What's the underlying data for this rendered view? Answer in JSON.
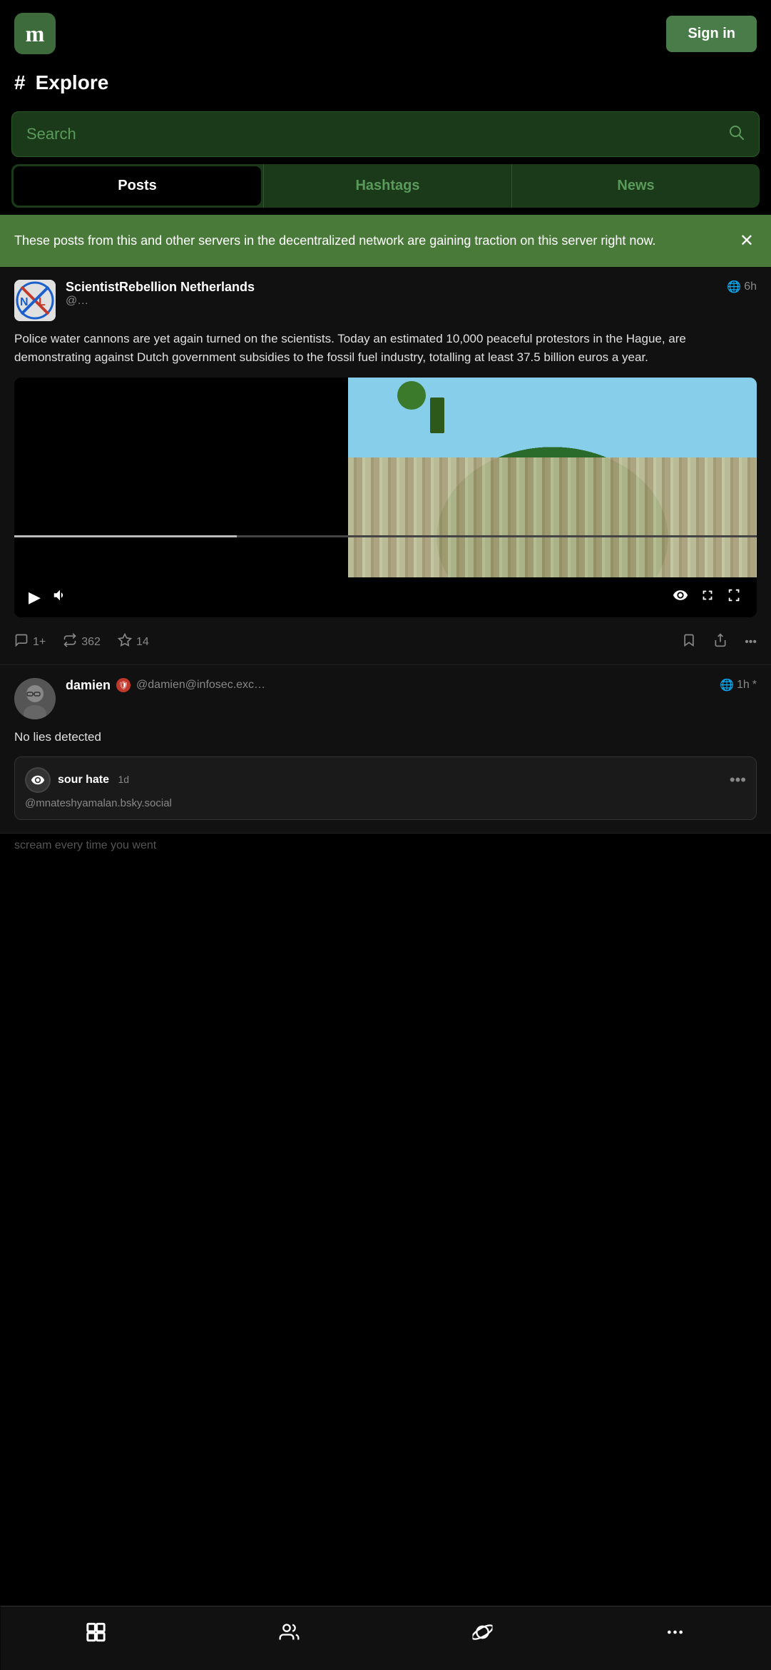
{
  "header": {
    "logo": "m",
    "sign_in": "Sign in"
  },
  "explore": {
    "hash_symbol": "#",
    "title": "Explore"
  },
  "search": {
    "placeholder": "Search"
  },
  "tabs": [
    {
      "id": "posts",
      "label": "Posts",
      "active": true
    },
    {
      "id": "hashtags",
      "label": "Hashtags",
      "active": false
    },
    {
      "id": "news",
      "label": "News",
      "active": false
    }
  ],
  "banner": {
    "text": "These posts from this and other servers in the decentralized network are gaining traction on this server right now.",
    "close": "✕"
  },
  "posts": [
    {
      "id": "post1",
      "author": "ScientistRebellion Netherlands",
      "handle": "@…",
      "globe": "🌐",
      "time": "6h",
      "content": "Police water cannons are yet again turned on the scientists. Today an estimated 10,000 peaceful protestors in the Hague, are demonstrating against Dutch government subsidies to the fossil fuel industry, totalling at least 37.5 billion euros a year.",
      "has_video": true,
      "actions": {
        "comments": "1+",
        "boosts": "362",
        "favorites": "14"
      }
    },
    {
      "id": "post2",
      "author": "damien",
      "handle": "@damien@infosec.exc…",
      "globe": "🌐",
      "time": "1h",
      "time_suffix": "*",
      "content": "No lies detected",
      "quoted": {
        "name": "sour hate",
        "time": "1d",
        "handle": "@mnateshyamalan.bsky.social"
      }
    }
  ],
  "bottom_nav": {
    "explore_icon": "#",
    "people_icon": "👥",
    "planet_icon": "🪐",
    "more_icon": "•••"
  },
  "video_controls": {
    "play": "▶",
    "volume": "🔊",
    "eye": "👁",
    "expand": "⤢",
    "fullscreen": "⛶"
  }
}
